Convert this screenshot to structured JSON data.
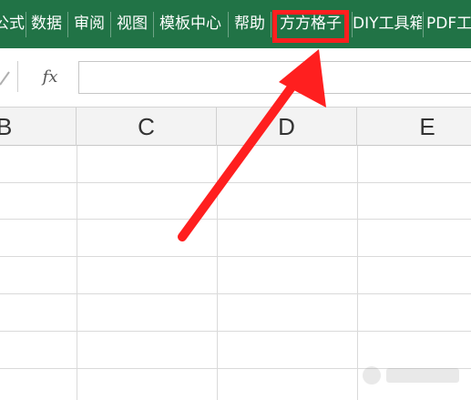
{
  "ribbon": {
    "tabs": [
      {
        "label": "公式"
      },
      {
        "label": "数据"
      },
      {
        "label": "审阅"
      },
      {
        "label": "视图"
      },
      {
        "label": "模板中心"
      },
      {
        "label": "帮助"
      },
      {
        "label": "方方格子"
      },
      {
        "label": "DIY工具箱"
      },
      {
        "label": "PDF工具"
      }
    ],
    "highlighted_tab": "方方格子",
    "bg_color": "#217346",
    "highlight_color": "#ff1f1f"
  },
  "formula_bar": {
    "fx_label": "fx",
    "value": ""
  },
  "columns": [
    "B",
    "C",
    "D",
    "E"
  ],
  "arrow": {
    "color": "#ff1f1f",
    "points_to": "方方格子"
  }
}
